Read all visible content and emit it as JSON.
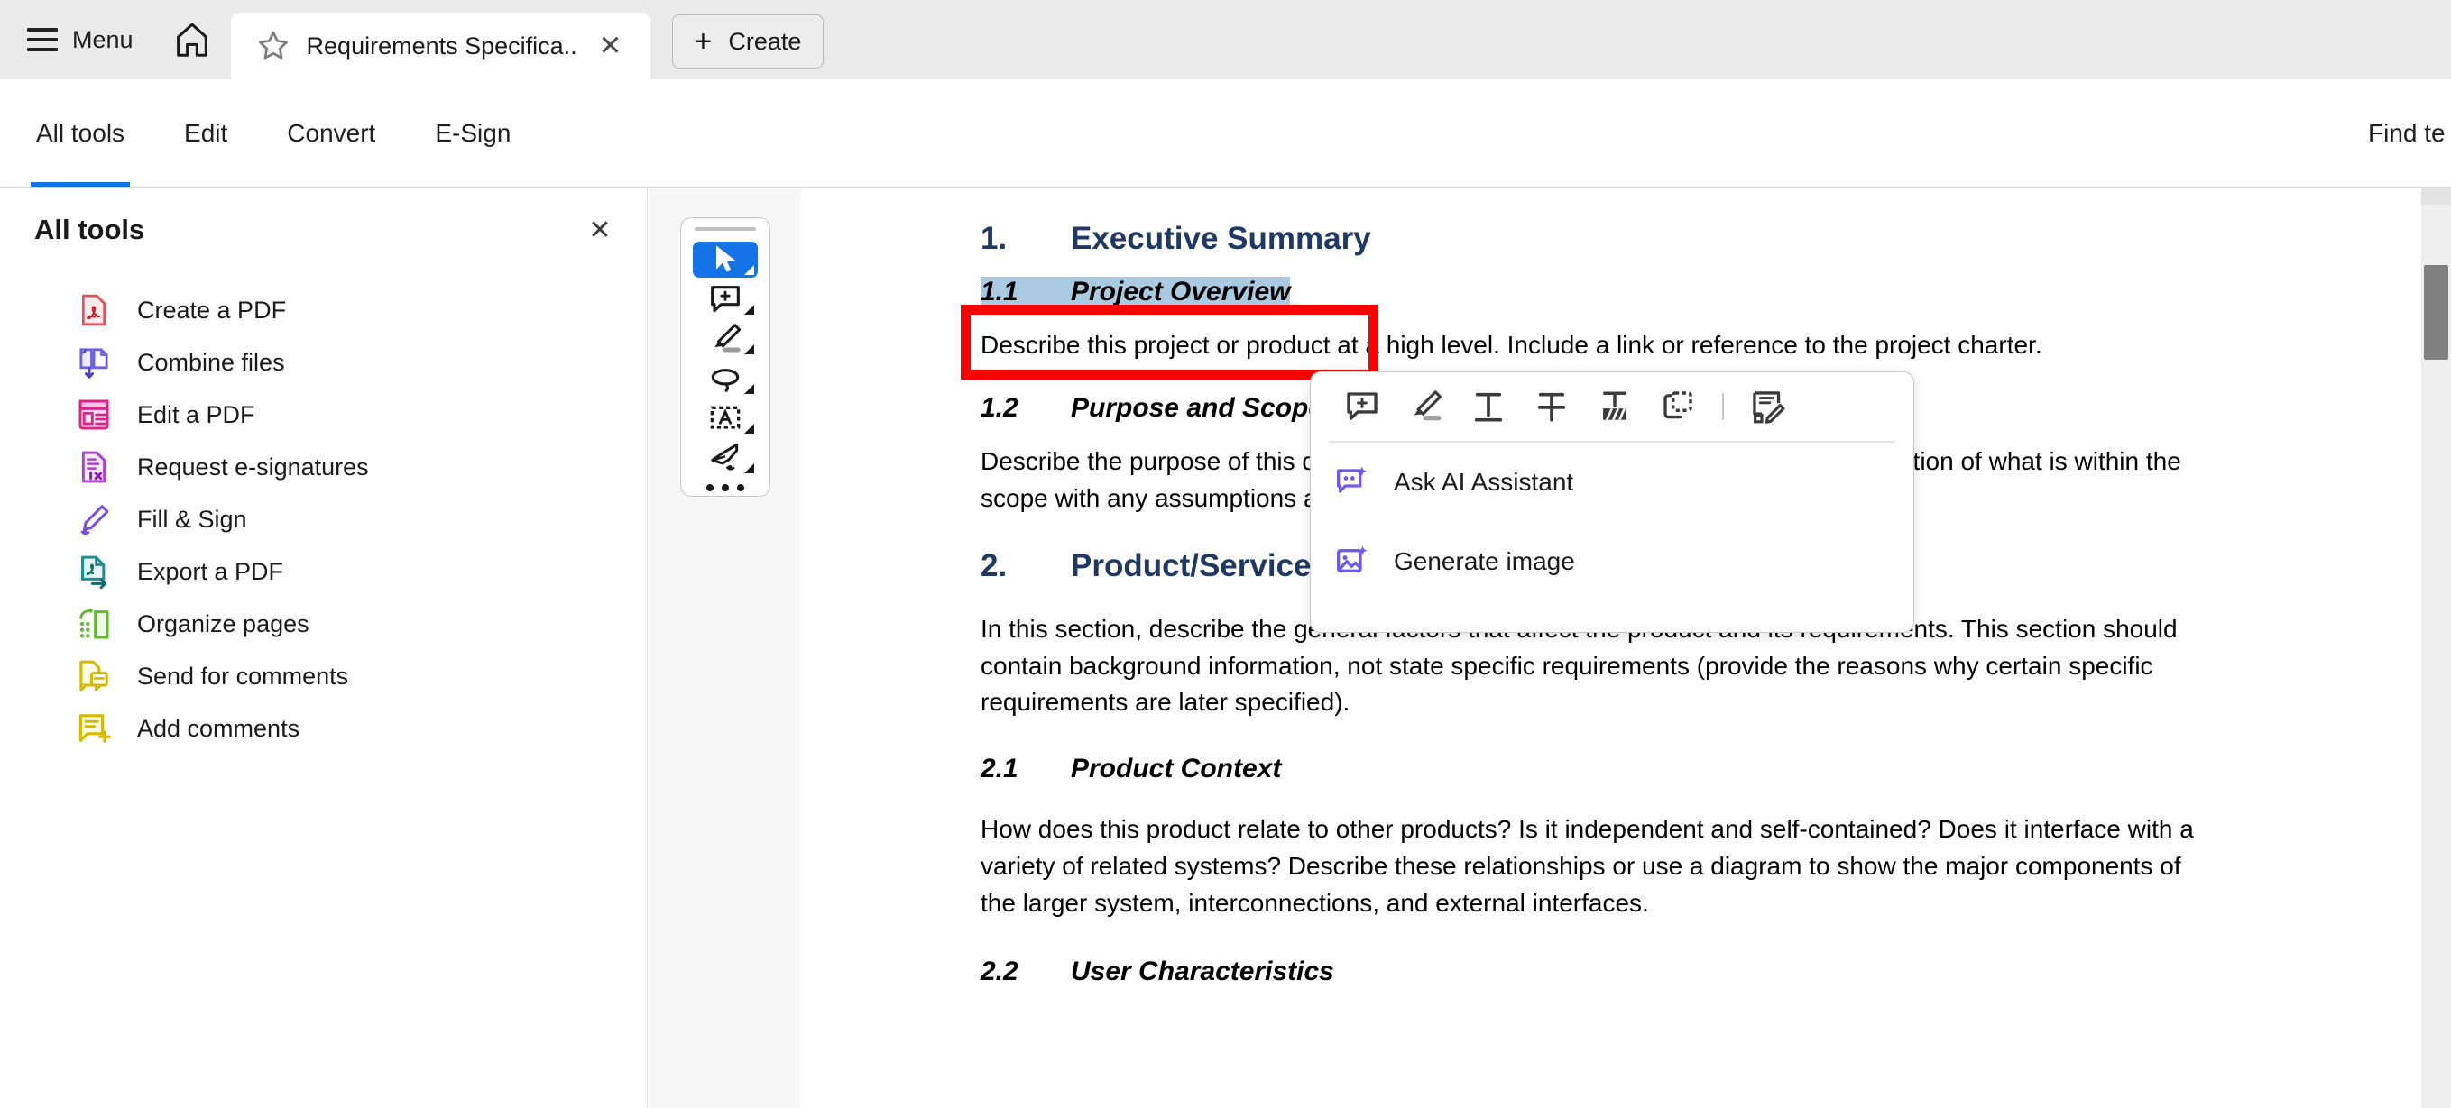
{
  "titlebar": {
    "menu_label": "Menu",
    "home_icon": "home-icon",
    "tab": {
      "star_icon": "star-icon",
      "title": "Requirements Specifica...",
      "close_label": "✕"
    },
    "create": {
      "plus": "+",
      "label": "Create"
    }
  },
  "toolbar": {
    "tabs": [
      {
        "label": "All tools",
        "active": true
      },
      {
        "label": "Edit",
        "active": false
      },
      {
        "label": "Convert",
        "active": false
      },
      {
        "label": "E-Sign",
        "active": false
      }
    ],
    "find_text": "Find te"
  },
  "left_panel": {
    "title": "All tools",
    "close_label": "✕",
    "tools": [
      {
        "label": "Create a PDF",
        "icon": "create-pdf-icon",
        "color": "#e8505b"
      },
      {
        "label": "Combine files",
        "icon": "combine-files-icon",
        "color": "#6c63e0"
      },
      {
        "label": "Edit a PDF",
        "icon": "edit-pdf-icon",
        "color": "#e0218a"
      },
      {
        "label": "Request e-signatures",
        "icon": "request-esignatures-icon",
        "color": "#b03fd4"
      },
      {
        "label": "Fill & Sign",
        "icon": "fill-and-sign-icon",
        "color": "#7a4be8"
      },
      {
        "label": "Export a PDF",
        "icon": "export-pdf-icon",
        "color": "#18918f"
      },
      {
        "label": "Organize pages",
        "icon": "organize-pages-icon",
        "color": "#62b832"
      },
      {
        "label": "Send for comments",
        "icon": "send-for-comments-icon",
        "color": "#d6b800"
      },
      {
        "label": "Add comments",
        "icon": "add-comments-icon",
        "color": "#d6b800"
      }
    ]
  },
  "tool_rail": {
    "buttons": [
      {
        "name": "select-tool",
        "active": true
      },
      {
        "name": "add-comment-tool",
        "active": false
      },
      {
        "name": "highlight-tool",
        "active": false
      },
      {
        "name": "draw-lasso-tool",
        "active": false
      },
      {
        "name": "text-box-tool",
        "active": false
      },
      {
        "name": "signature-pen-tool",
        "active": false
      }
    ],
    "more_label": "more-tools-icon"
  },
  "document": {
    "selection_text": "1.1\tProject Overview",
    "blocks": [
      {
        "type": "h1",
        "num": "1.",
        "text": "Executive Summary"
      },
      {
        "type": "h2",
        "num": "1.1",
        "text": "Project Overview",
        "highlighted": true
      },
      {
        "type": "para",
        "text": "Describe this project or product at a high level.  Include a link or reference to the project charter."
      },
      {
        "type": "h2",
        "num": "1.2",
        "text": "Purpose and Scope",
        "highlighted": false
      },
      {
        "type": "para",
        "text": "Describe the purpose of this document and its intended audience.  Include a description of what is within the scope with any assumptions and exclusions.  For example:"
      },
      {
        "type": "h1",
        "num": "2.",
        "text": "Product/Service Description"
      },
      {
        "type": "para",
        "text": "In this section, describe the general factors that affect the product and its requirements. This section should contain background information, not state specific requirements (provide the reasons why certain specific requirements are later specified)."
      },
      {
        "type": "h2",
        "num": "2.1",
        "text": "Product Context",
        "highlighted": false
      },
      {
        "type": "para",
        "text": "How does this product relate to other products? Is it independent and self-contained?  Does it interface with a variety of related systems?  Describe these relationships or use a diagram to show the major components of the larger system, interconnections, and external interfaces."
      },
      {
        "type": "h2",
        "num": "2.2",
        "text": "User Characteristics",
        "highlighted": false
      }
    ]
  },
  "popup": {
    "tools": [
      {
        "name": "add-comment-icon"
      },
      {
        "name": "highlight-icon"
      },
      {
        "name": "underline-icon"
      },
      {
        "name": "strikethrough-icon"
      },
      {
        "name": "redact-icon"
      },
      {
        "name": "copy-area-icon"
      },
      {
        "name": "divider"
      },
      {
        "name": "edit-document-icon"
      }
    ],
    "menu_items": [
      {
        "label": "Ask AI Assistant",
        "icon": "ask-ai-assistant-icon"
      },
      {
        "label": "Generate image",
        "icon": "generate-image-icon"
      }
    ]
  },
  "colors": {
    "accent_blue": "#1473e6",
    "heading_blue": "#1F3864",
    "selection_highlight": "#a9cae0",
    "annotation_red": "#ff0000",
    "ai_purple": "#6c5ce7"
  }
}
